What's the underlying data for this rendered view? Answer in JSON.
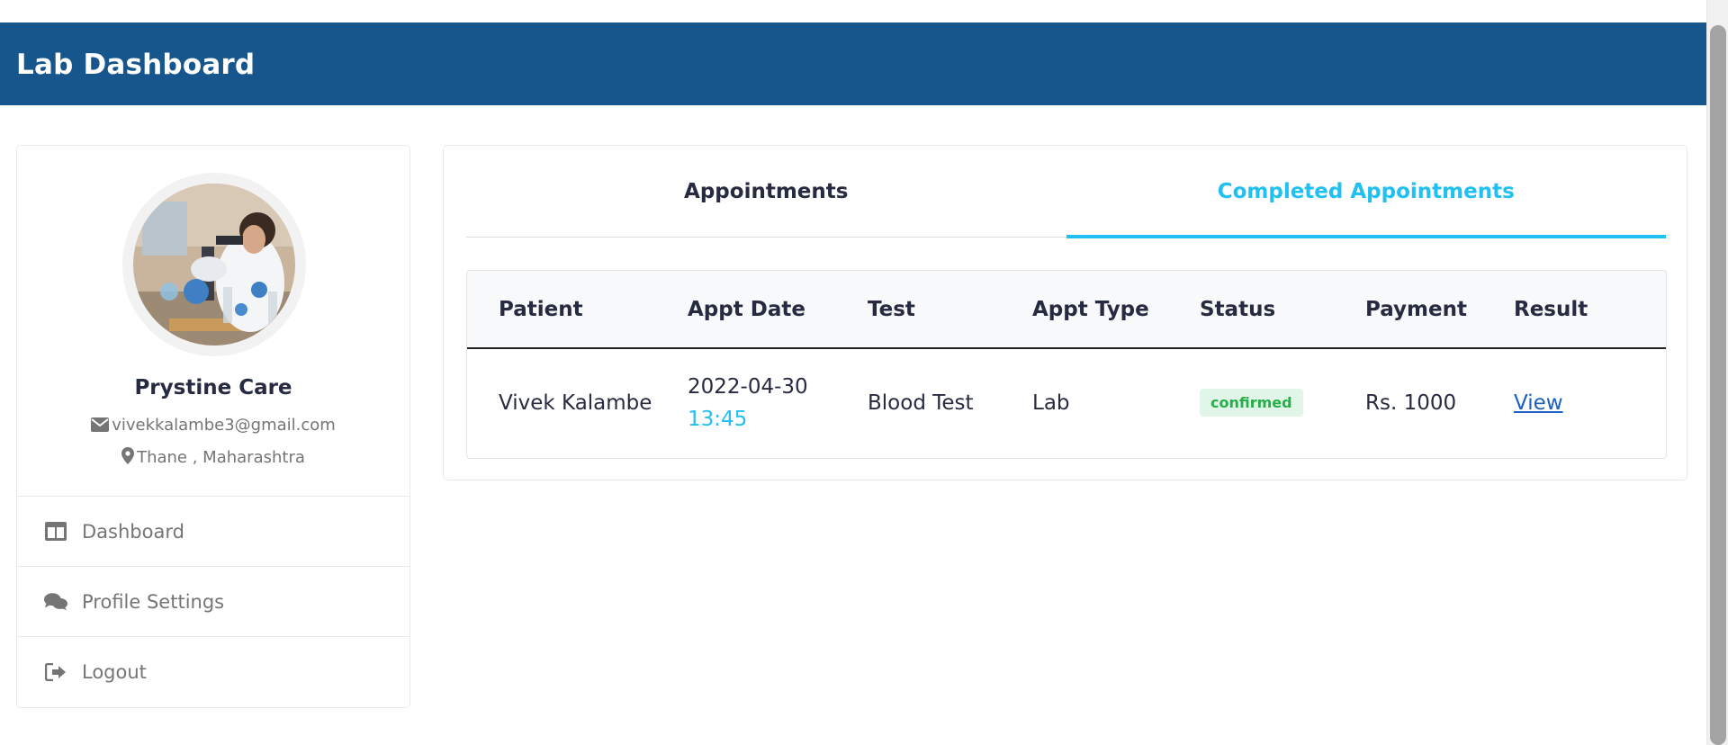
{
  "header": {
    "title": "Lab Dashboard"
  },
  "profile": {
    "name": "Prystine Care",
    "email": "vivekkalambe3@gmail.com",
    "location": "Thane , Maharashtra"
  },
  "sidebar": {
    "items": [
      {
        "label": "Dashboard",
        "icon": "columns-icon"
      },
      {
        "label": "Profile Settings",
        "icon": "comments-icon"
      },
      {
        "label": "Logout",
        "icon": "sign-out-icon"
      }
    ]
  },
  "tabs": [
    {
      "label": "Appointments",
      "active": false
    },
    {
      "label": "Completed Appointments",
      "active": true
    }
  ],
  "table": {
    "headers": [
      "Patient",
      "Appt Date",
      "Test",
      "Appt Type",
      "Status",
      "Payment",
      "Result"
    ],
    "rows": [
      {
        "patient": "Vivek Kalambe",
        "date": "2022-04-30",
        "time": "13:45",
        "test": "Blood Test",
        "type": "Lab",
        "status": "confirmed",
        "payment": "Rs. 1000",
        "result": "View"
      }
    ]
  },
  "colors": {
    "header_bg": "#17558d",
    "accent": "#20c0f3",
    "status_bg": "#e1f6e9",
    "status_text": "#26af48",
    "link": "#1b5fc1"
  }
}
